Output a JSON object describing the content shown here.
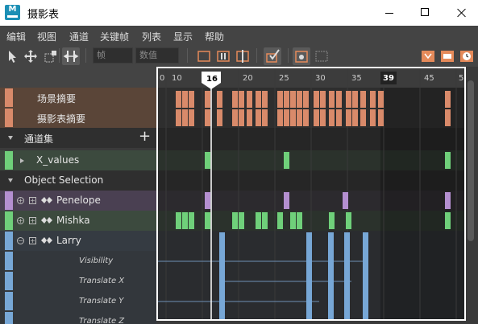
{
  "window": {
    "title": "摄影表",
    "app_icon": "M"
  },
  "menu": [
    "编辑",
    "视图",
    "通道",
    "关键帧",
    "列表",
    "显示",
    "帮助"
  ],
  "toolbar": {
    "frame_placeholder": "帧",
    "value_placeholder": "数值"
  },
  "left": {
    "scene_summary": "场景摘要",
    "dopesheet_summary": "摄影表摘要",
    "channel_set": "通道集",
    "add": "+",
    "x_values": "X_values",
    "object_selection": "Object Selection",
    "penelope": "Penelope",
    "mishka": "Mishka",
    "larry": "Larry",
    "visibility": "Visibility",
    "translate_x": "Translate X",
    "translate_y": "Translate Y",
    "translate_z": "Translate Z"
  },
  "timeline": {
    "ticks": [
      "0",
      "10",
      "16",
      "20",
      "25",
      "30",
      "35",
      "39",
      "45",
      "5"
    ],
    "current_frame": "16",
    "range_end": "39"
  },
  "colors": {
    "summary": "#d98a6a",
    "channel": "#6fd07a",
    "penelope": "#b48fd0",
    "larry": "#77a7d6",
    "titlebar": "#ffffff"
  }
}
